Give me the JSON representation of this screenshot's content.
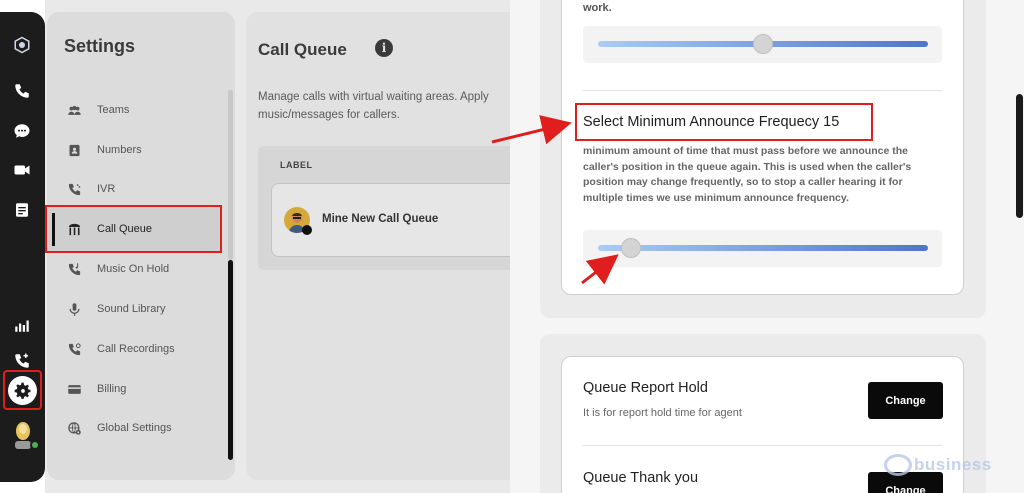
{
  "settings": {
    "title": "Settings",
    "menu": [
      {
        "label": "Teams",
        "icon": "teams-icon"
      },
      {
        "label": "Numbers",
        "icon": "numbers-icon"
      },
      {
        "label": "IVR",
        "icon": "ivr-icon"
      },
      {
        "label": "Call Queue",
        "icon": "call-queue-icon",
        "selected": true
      },
      {
        "label": "Music On Hold",
        "icon": "music-on-hold-icon"
      },
      {
        "label": "Sound Library",
        "icon": "microphone-icon"
      },
      {
        "label": "Call Recordings",
        "icon": "call-recordings-icon"
      },
      {
        "label": "Billing",
        "icon": "credit-card-icon"
      },
      {
        "label": "Global Settings",
        "icon": "globe-gear-icon"
      }
    ]
  },
  "call_queue": {
    "title": "Call Queue",
    "info_glyph": "i",
    "description_line1": "Manage calls with virtual waiting areas. Apply",
    "description_line2": "music/messages for callers.",
    "table_header": "LABEL",
    "rows": [
      {
        "name": "Mine New Call Queue"
      }
    ]
  },
  "drawer": {
    "work_text": "work.",
    "slider1": {
      "value_fraction": 0.5
    },
    "min_announce": {
      "title": "Select Minimum Announce Frequecy 15",
      "description": "minimum amount of time that must pass before we announce the caller's position in the queue again. This is used when the caller's position may change frequently, so to stop a caller hearing it for multiple times we use minimum announce frequency.",
      "value_fraction": 0.1
    },
    "queue_report_hold": {
      "title": "Queue Report Hold",
      "subtitle": "It is for report hold time for agent",
      "button": "Change"
    },
    "queue_thank_you": {
      "title": "Queue Thank you",
      "button": "Change"
    }
  },
  "watermark": "business",
  "colors": {
    "highlight": "#e01e1e",
    "slider_start": "#a9cdf4",
    "slider_end": "#4f75c9",
    "button_bg": "#0a0a0a"
  }
}
